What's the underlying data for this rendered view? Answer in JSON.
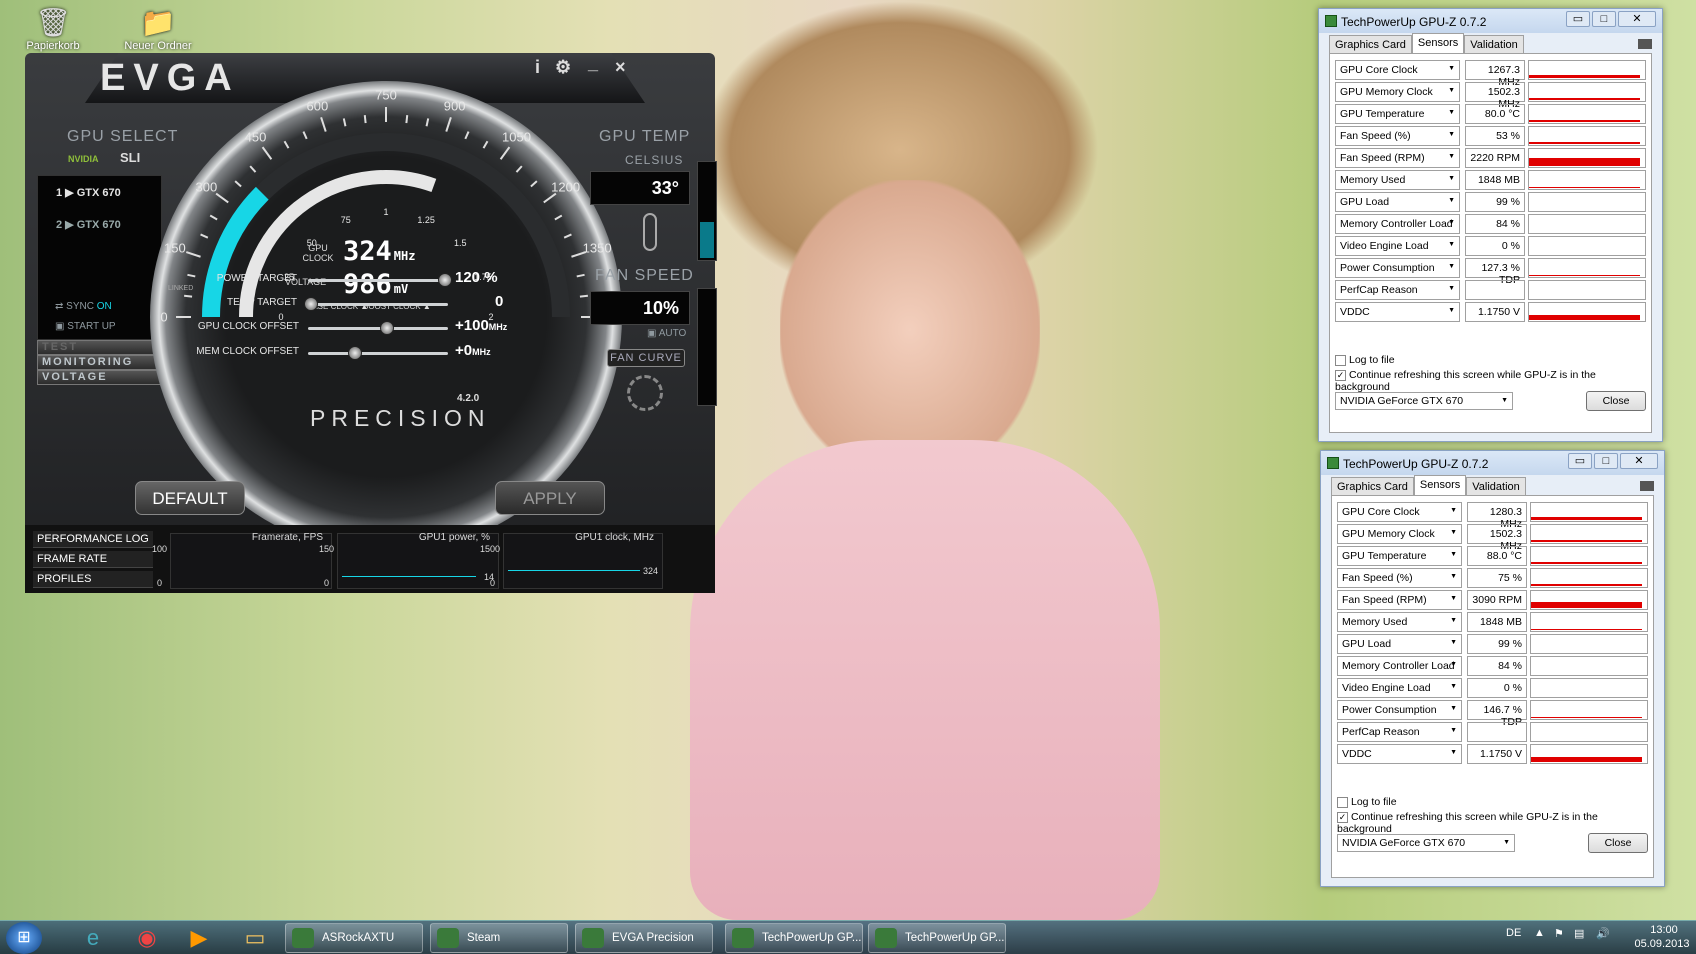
{
  "desktop": {
    "icons": [
      {
        "label": "Papierkorb",
        "icon": "recycle-bin-icon"
      },
      {
        "label": "Neuer Ordner",
        "icon": "folder-icon"
      }
    ]
  },
  "evga": {
    "logo": "EVGA",
    "controls": {
      "info": "i",
      "settings": "⚙",
      "minimize": "_",
      "close": "×"
    },
    "gpu_select_label": "GPU SELECT",
    "nvidia_label": "NVIDIA",
    "sli_label": "SLI",
    "gpus": [
      "1 ▶ GTX 670",
      "2 ▶ GTX 670"
    ],
    "sync_label": "SYNC",
    "sync_state": "ON",
    "startup_label": "START UP",
    "side_buttons": [
      "TEST",
      "MONITORING",
      "VOLTAGE"
    ],
    "gauge_ticks": [
      "0",
      "150",
      "300",
      "450",
      "600",
      "750",
      "900",
      "1050",
      "1200",
      "1350",
      "1500"
    ],
    "inner_ticks": [
      "0",
      "25",
      "50",
      "75",
      "1",
      "1.25",
      "1.5",
      "1.75",
      "2"
    ],
    "gpu_clock_label": "GPU CLOCK",
    "gpu_clock_value": "324",
    "gpu_clock_unit": "MHz",
    "voltage_label": "VOLTAGE",
    "voltage_value": "986",
    "voltage_unit": "mV",
    "base_clock_label": "BASE CLOCK ▲",
    "boost_clock_label": "BOOST CLOCK ▲",
    "gpu_temp_label": "GPU TEMP",
    "celsius_label": "CELSIUS",
    "temp_value": "33°",
    "fan_speed_label": "FAN SPEED",
    "fan_value": "10%",
    "auto_label": "AUTO",
    "fan_curve_label": "FAN CURVE",
    "linked_label": "LINKED",
    "sliders": [
      {
        "label": "POWER TARGET",
        "value": "120 %",
        "pos": 1.0
      },
      {
        "label": "TEMP TARGET",
        "value": "0",
        "pos": 0.0
      },
      {
        "label": "GPU CLOCK OFFSET",
        "value": "+100",
        "unit": "MHz",
        "pos": 0.57
      },
      {
        "label": "MEM CLOCK OFFSET",
        "value": "+0",
        "unit": "MHz",
        "pos": 0.33
      }
    ],
    "version": "4.2.0",
    "precision_label": "PRECISION",
    "default_button": "DEFAULT",
    "apply_button": "APPLY",
    "log_buttons": [
      "PERFORMANCE LOG",
      "FRAME RATE TARGET",
      "PROFILES"
    ],
    "graphs": [
      {
        "title": "Framerate, FPS",
        "max": "100",
        "min": "0",
        "current": ""
      },
      {
        "title": "GPU1 power, %",
        "max": "150",
        "min": "0",
        "current": "14"
      },
      {
        "title": "GPU1 clock, MHz",
        "max": "1500",
        "min": "0",
        "current": "324"
      }
    ]
  },
  "gpuz1": {
    "title": "TechPowerUp GPU-Z 0.7.2",
    "tabs": [
      "Graphics Card",
      "Sensors",
      "Validation"
    ],
    "active_tab": "Sensors",
    "rows": [
      {
        "name": "GPU Core Clock",
        "value": "1267.3 MHz",
        "bar": 0.15
      },
      {
        "name": "GPU Memory Clock",
        "value": "1502.3 MHz",
        "bar": 0.1
      },
      {
        "name": "GPU Temperature",
        "value": "80.0 °C",
        "bar": 0.1
      },
      {
        "name": "Fan Speed (%)",
        "value": "53 %",
        "bar": 0.12
      },
      {
        "name": "Fan Speed (RPM)",
        "value": "2220 RPM",
        "bar": 0.45
      },
      {
        "name": "Memory Used",
        "value": "1848 MB",
        "bar": 0.08
      },
      {
        "name": "GPU Load",
        "value": "99 %",
        "bar": 0.0
      },
      {
        "name": "Memory Controller Load",
        "value": "84 %",
        "bar": 0.0
      },
      {
        "name": "Video Engine Load",
        "value": "0 %",
        "bar": 0.0
      },
      {
        "name": "Power Consumption",
        "value": "127.3 % TDP",
        "bar": 0.08
      },
      {
        "name": "PerfCap Reason",
        "value": "",
        "bar": 0.0
      },
      {
        "name": "VDDC",
        "value": "1.1750 V",
        "bar": 0.3
      }
    ],
    "log_to_file": "Log to file",
    "continue_refresh": "Continue refreshing this screen while GPU-Z is in the background",
    "gpu_select": "NVIDIA GeForce GTX 670",
    "close": "Close"
  },
  "gpuz2": {
    "title": "TechPowerUp GPU-Z 0.7.2",
    "tabs": [
      "Graphics Card",
      "Sensors",
      "Validation"
    ],
    "active_tab": "Sensors",
    "rows": [
      {
        "name": "GPU Core Clock",
        "value": "1280.3 MHz",
        "bar": 0.15
      },
      {
        "name": "GPU Memory Clock",
        "value": "1502.3 MHz",
        "bar": 0.1
      },
      {
        "name": "GPU Temperature",
        "value": "88.0 °C",
        "bar": 0.12
      },
      {
        "name": "Fan Speed (%)",
        "value": "75 %",
        "bar": 0.12
      },
      {
        "name": "Fan Speed (RPM)",
        "value": "3090 RPM",
        "bar": 0.35
      },
      {
        "name": "Memory Used",
        "value": "1848 MB",
        "bar": 0.08
      },
      {
        "name": "GPU Load",
        "value": "99 %",
        "bar": 0.0
      },
      {
        "name": "Memory Controller Load",
        "value": "84 %",
        "bar": 0.0
      },
      {
        "name": "Video Engine Load",
        "value": "0 %",
        "bar": 0.0
      },
      {
        "name": "Power Consumption",
        "value": "146.7 % TDP",
        "bar": 0.08
      },
      {
        "name": "PerfCap Reason",
        "value": "",
        "bar": 0.0
      },
      {
        "name": "VDDC",
        "value": "1.1750 V",
        "bar": 0.3
      }
    ],
    "log_to_file": "Log to file",
    "continue_refresh": "Continue refreshing this screen while GPU-Z is in the background",
    "gpu_select": "NVIDIA GeForce GTX 670",
    "close": "Close"
  },
  "taskbar": {
    "items": [
      {
        "label": "ASRockAXTU",
        "icon": "asrock-icon"
      },
      {
        "label": "Steam",
        "icon": "steam-icon"
      },
      {
        "label": "EVGA Precision",
        "icon": "evga-icon"
      },
      {
        "label": "TechPowerUp GP...",
        "icon": "gpuz-icon"
      },
      {
        "label": "TechPowerUp GP...",
        "icon": "gpuz-icon"
      }
    ],
    "language": "DE",
    "time": "13:00",
    "date": "05.09.2013"
  },
  "colors": {
    "evga_cyan": "#17d6e6",
    "gpuz_red": "#e00000",
    "taskbar": "#2d4b60"
  }
}
